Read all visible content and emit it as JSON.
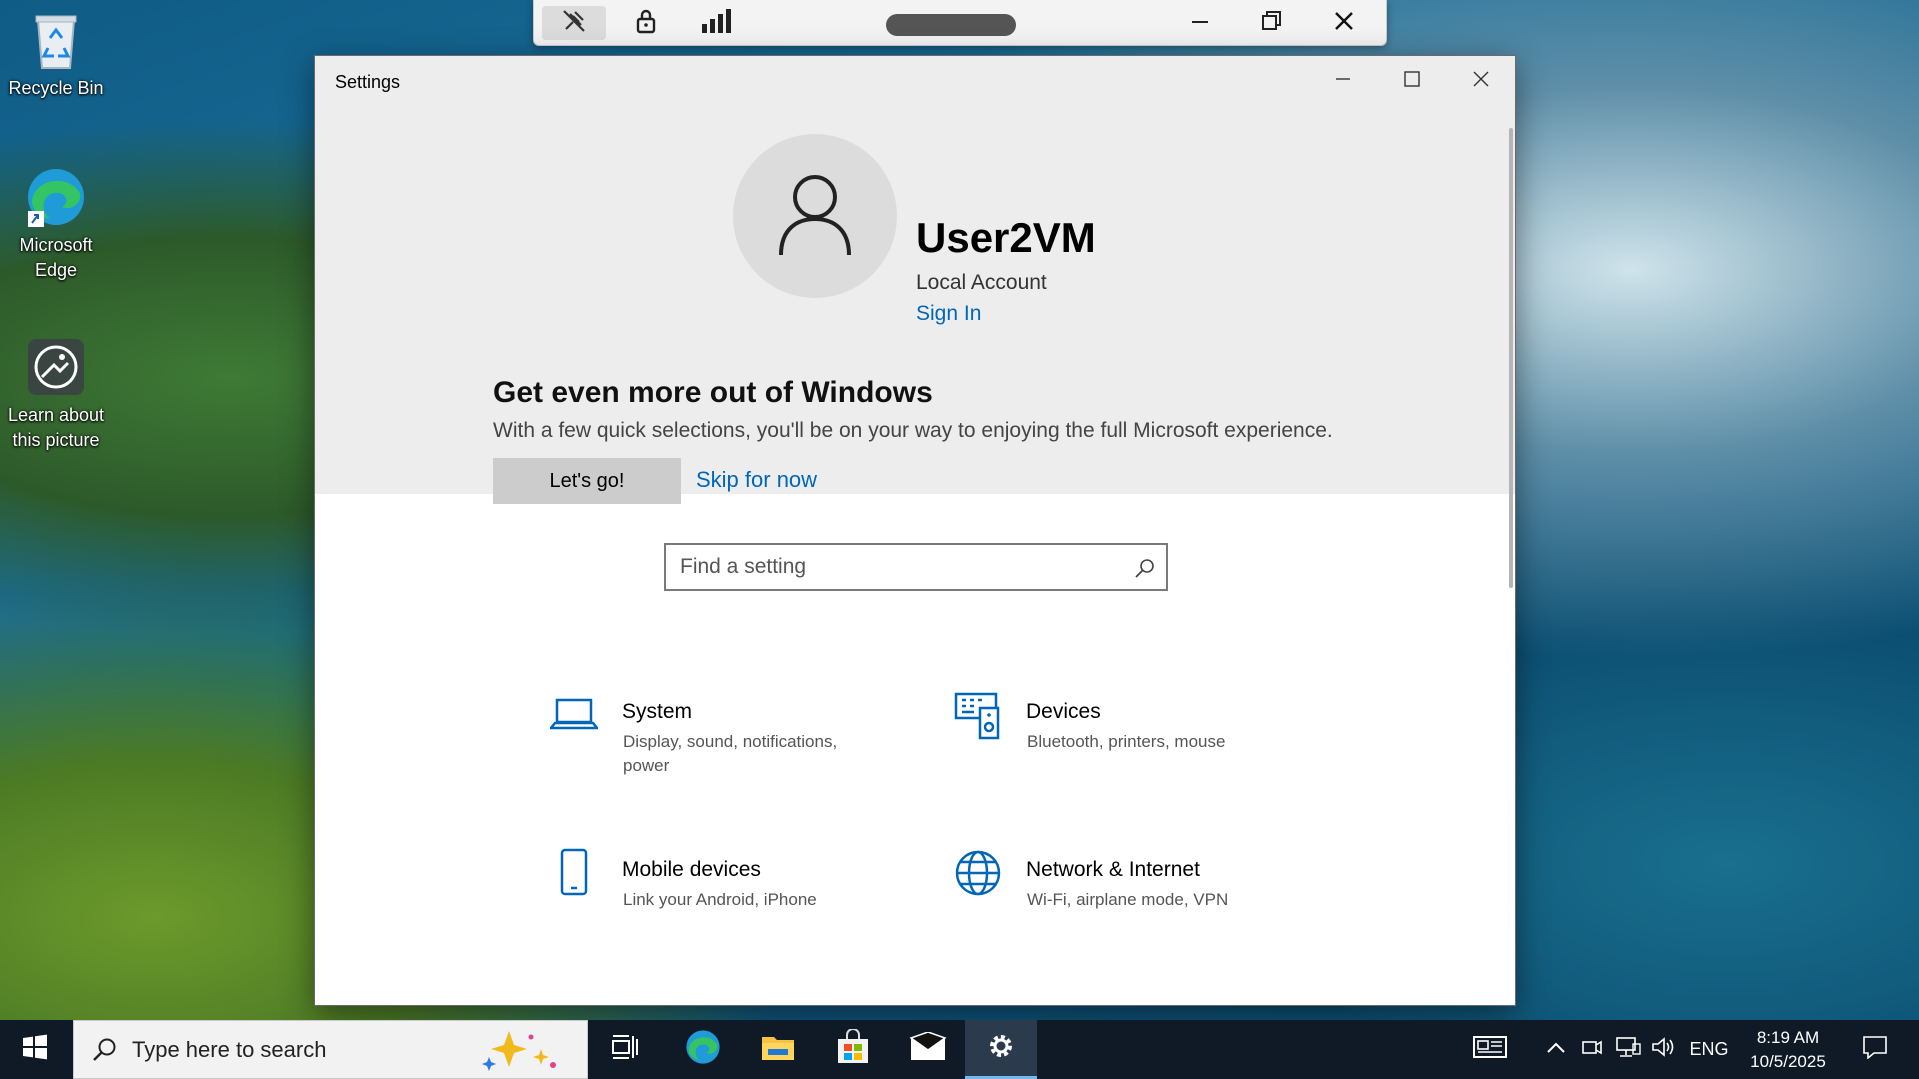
{
  "desktop": {
    "icons": [
      {
        "label": "Recycle Bin"
      },
      {
        "label": "Microsoft Edge"
      },
      {
        "label": "Learn about this picture"
      }
    ]
  },
  "settings": {
    "window_title": "Settings",
    "user": {
      "name": "User2VM",
      "account_type": "Local Account",
      "sign_in_label": "Sign In"
    },
    "promo": {
      "title": "Get even more out of Windows",
      "text": "With a few quick selections, you'll be on your way to enjoying the full Microsoft experience.",
      "primary_label": "Let's go!",
      "skip_label": "Skip for now"
    },
    "search": {
      "placeholder": "Find a setting"
    },
    "categories": [
      {
        "name": "System",
        "desc": "Display, sound, notifications, power",
        "icon": "laptop-icon"
      },
      {
        "name": "Devices",
        "desc": "Bluetooth, printers, mouse",
        "icon": "devices-icon"
      },
      {
        "name": "Mobile devices",
        "desc": "Link your Android, iPhone",
        "icon": "phone-icon"
      },
      {
        "name": "Network & Internet",
        "desc": "Wi-Fi, airplane mode, VPN",
        "icon": "globe-icon"
      }
    ]
  },
  "taskbar": {
    "search_placeholder": "Type here to search",
    "language": "ENG",
    "time": "8:19 AM",
    "date": "10/5/2025"
  },
  "colors": {
    "accent": "#0067b8",
    "taskbar": "#101a26",
    "settings_gear_active": "#2b3a4c"
  }
}
